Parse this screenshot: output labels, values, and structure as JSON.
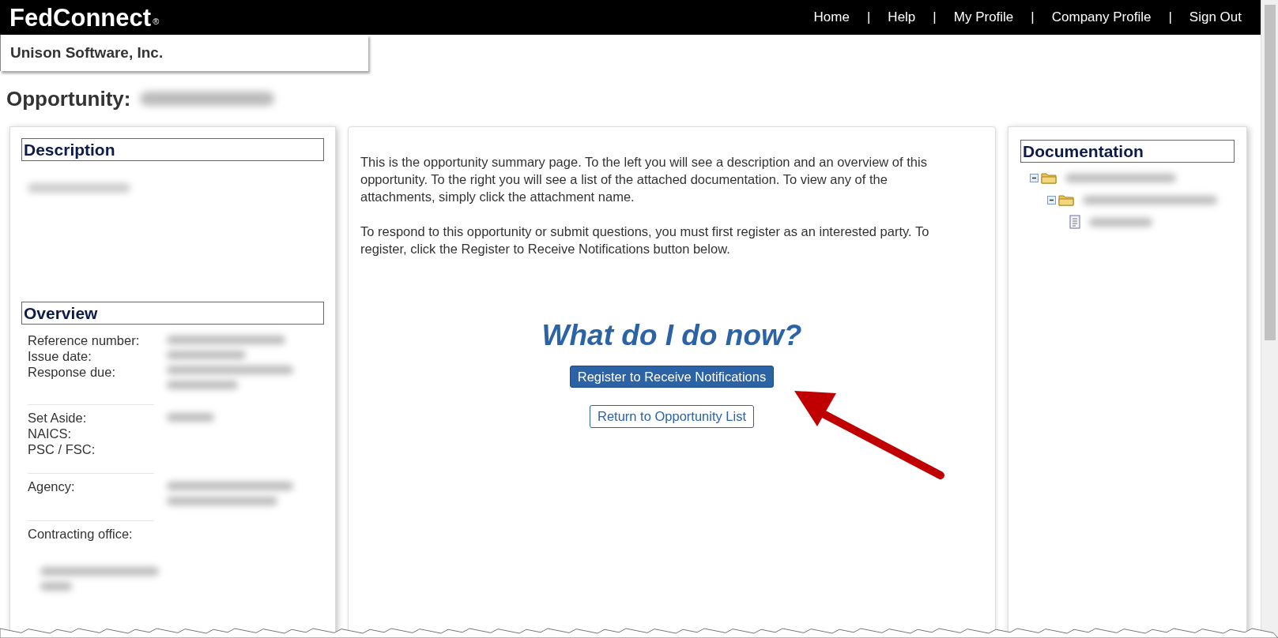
{
  "header": {
    "logo": "FedConnect",
    "registered_mark": "®",
    "nav": [
      {
        "label": "Home"
      },
      {
        "label": "Help"
      },
      {
        "label": "My Profile"
      },
      {
        "label": "Company Profile"
      },
      {
        "label": "Sign Out"
      }
    ],
    "nav_separators": [
      "|",
      "|",
      "|",
      "|"
    ]
  },
  "company": "Unison Software, Inc.",
  "page_title": "Opportunity:",
  "description": {
    "title": "Description"
  },
  "overview": {
    "title": "Overview",
    "groups": [
      {
        "labels": [
          "Reference number:",
          "Issue date:",
          "Response due:"
        ]
      },
      {
        "labels": [
          "Set Aside:",
          "NAICS:",
          "PSC / FSC:"
        ]
      },
      {
        "labels": [
          "Agency:"
        ]
      },
      {
        "labels": [
          "Contracting office:"
        ]
      }
    ]
  },
  "summary": {
    "paragraphs": [
      "This is the opportunity summary page. To the left you will see a description and an overview of this opportunity. To the right you will see a list of the attached documentation. To view any of the attachments, simply click the attachment name.",
      "To respond to this opportunity or submit questions, you must first register as an interested party. To register, click the Register to Receive Notifications button below."
    ],
    "heading": "What do I do now?",
    "buttons": [
      {
        "label": "Register to Receive Notifications",
        "kind": "primary"
      },
      {
        "label": "Return to Opportunity List",
        "kind": "secondary"
      }
    ]
  },
  "documentation": {
    "title": "Documentation",
    "tree": [
      {
        "kind": "folder",
        "expanded": true,
        "children": [
          {
            "kind": "folder",
            "expanded": true,
            "children": [
              {
                "kind": "document"
              }
            ]
          }
        ]
      }
    ]
  }
}
